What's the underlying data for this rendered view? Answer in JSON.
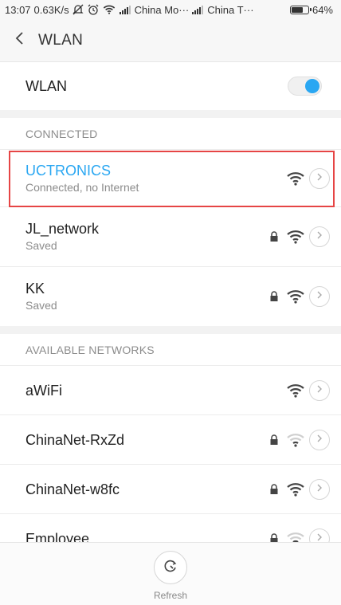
{
  "status_bar": {
    "time": "13:07",
    "speed": "0.63K/s",
    "carrier1": "China Mo···",
    "carrier2": "China T···",
    "battery": "64%",
    "battery_level": 0.64
  },
  "header": {
    "title": "WLAN"
  },
  "wlan_toggle": {
    "label": "WLAN",
    "enabled": true
  },
  "sections": {
    "connected": "CONNECTED",
    "available": "AVAILABLE NETWORKS"
  },
  "connected_networks": [
    {
      "name": "UCTRONICS",
      "status": "Connected, no Internet",
      "secured": false,
      "signal": "strong",
      "active": true
    },
    {
      "name": "JL_network",
      "status": "Saved",
      "secured": true,
      "signal": "strong",
      "active": false
    },
    {
      "name": "KK",
      "status": "Saved",
      "secured": true,
      "signal": "strong",
      "active": false
    }
  ],
  "available_networks": [
    {
      "name": "aWiFi",
      "secured": false,
      "signal": "strong"
    },
    {
      "name": "ChinaNet-RxZd",
      "secured": true,
      "signal": "weak"
    },
    {
      "name": "ChinaNet-w8fc",
      "secured": true,
      "signal": "strong"
    },
    {
      "name": "Employee",
      "secured": true,
      "signal": "weak"
    }
  ],
  "bottom": {
    "refresh_label": "Refresh"
  },
  "colors": {
    "accent": "#2aa7f2",
    "highlight": "#e64545"
  },
  "icons": [
    "back-arrow-icon",
    "wifi-icon",
    "lock-icon",
    "chevron-right-icon",
    "refresh-icon"
  ]
}
